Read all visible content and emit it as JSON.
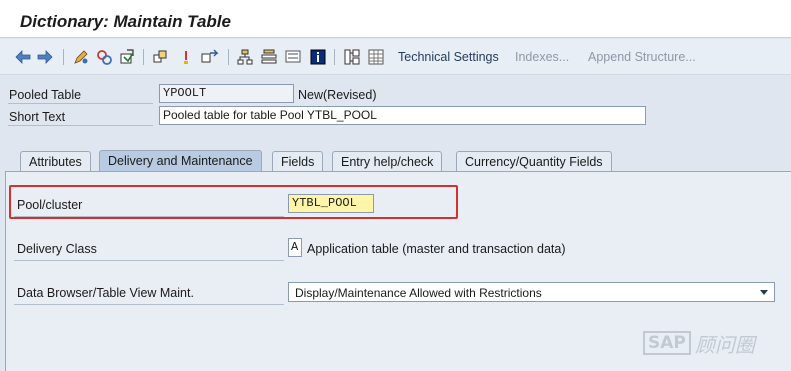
{
  "window": {
    "title": "Dictionary: Maintain Table"
  },
  "toolbar": {
    "technical_settings": "Technical Settings",
    "indexes": "Indexes...",
    "append_structure": "Append Structure..."
  },
  "header": {
    "pooled_table_label": "Pooled Table",
    "pooled_table_value": "YPOOLT",
    "status": "New(Revised)",
    "short_text_label": "Short Text",
    "short_text_value": "Pooled table for table Pool YTBL_POOL"
  },
  "tabs": [
    {
      "label": "Attributes"
    },
    {
      "label": "Delivery and Maintenance"
    },
    {
      "label": "Fields"
    },
    {
      "label": "Entry help/check"
    },
    {
      "label": "Currency/Quantity Fields"
    }
  ],
  "active_tab": "Delivery and Maintenance",
  "panel": {
    "pool_cluster_label": "Pool/cluster",
    "pool_cluster_value": "YTBL_POOL",
    "delivery_class_label": "Delivery Class",
    "delivery_class_value": "A",
    "delivery_class_desc": "Application table (master and transaction data)",
    "data_browser_label": "Data Browser/Table View Maint.",
    "data_browser_value": "Display/Maintenance Allowed with Restrictions"
  },
  "watermark": {
    "logo": "SAP",
    "text": "顾问圈"
  },
  "colors": {
    "highlight": "#d43030",
    "active_tab": "#b8cbe2",
    "input_highlight": "#fff5a8"
  }
}
